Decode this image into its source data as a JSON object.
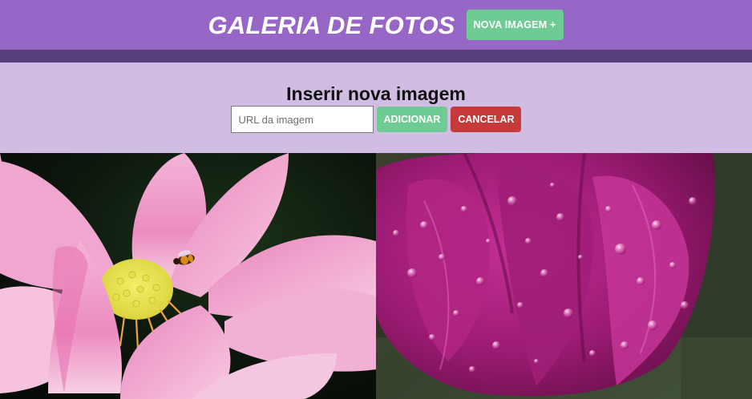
{
  "header": {
    "title": "GALERIA DE FOTOS",
    "new_image_button": "NOVA IMAGEM +"
  },
  "form": {
    "title": "Inserir nova imagem",
    "url_placeholder": "URL da imagem",
    "url_value": "",
    "add_button": "ADICIONAR",
    "cancel_button": "CANCELAR"
  },
  "gallery": {
    "images": [
      {
        "subject": "pink lotus flower with bee"
      },
      {
        "subject": "magenta tulip with water drops"
      }
    ]
  },
  "colors": {
    "header_bg": "#9667c6",
    "divider": "#563d7c",
    "form_bg": "#d1bde4",
    "accent_green": "#6fcb94",
    "cancel_red": "#c73a3a"
  }
}
